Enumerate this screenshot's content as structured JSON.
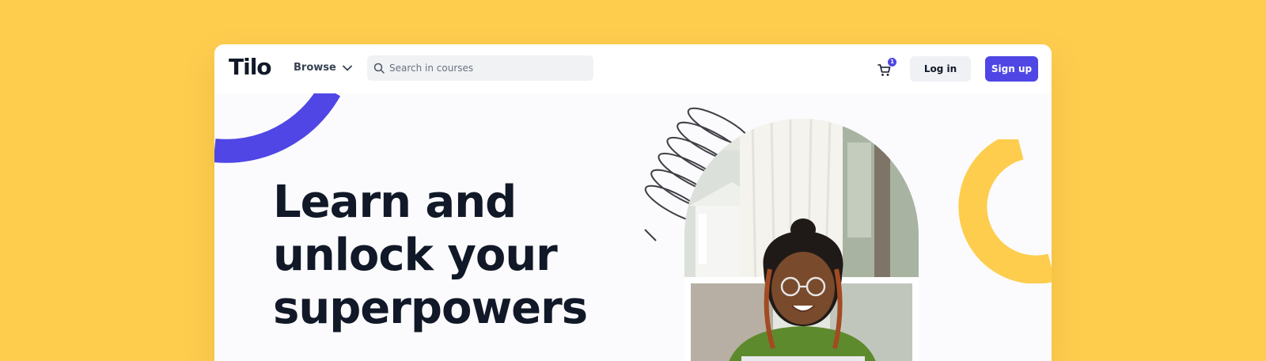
{
  "header": {
    "logo": "Tilo",
    "browse_label": "Browse",
    "search_placeholder": "Search in courses",
    "cart_count": "1",
    "login_label": "Log in",
    "signup_label": "Sign up"
  },
  "hero": {
    "title": "Learn and unlock your superpowers"
  },
  "icons": {
    "browse": "chevron-down-icon",
    "search": "search-icon",
    "cart": "cart-icon"
  },
  "colors": {
    "page_background": "#FECD4E",
    "accent": "#4F46E5",
    "text_primary": "#111827",
    "button_secondary": "#EFF1F5"
  }
}
